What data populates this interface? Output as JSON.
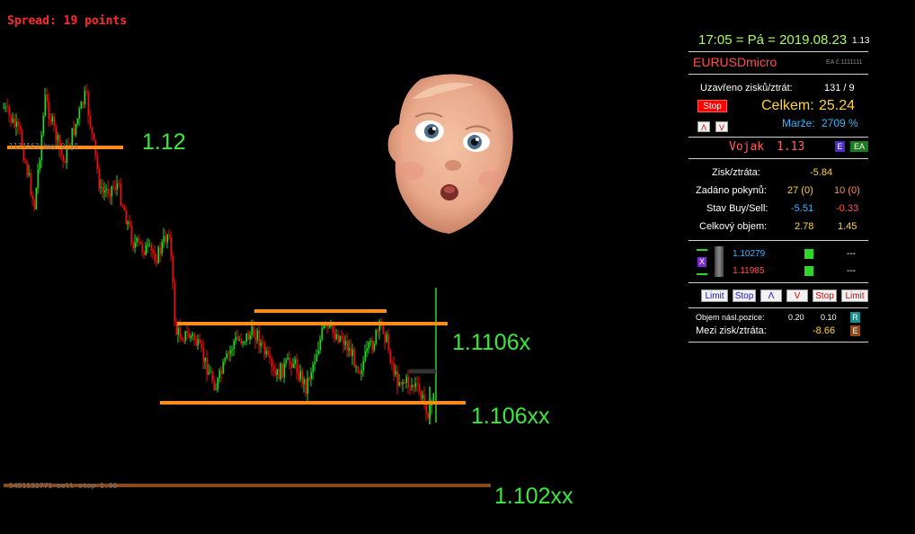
{
  "header": {
    "spread": "Spread: 19 points"
  },
  "levels": {
    "l1": "1.12",
    "l2": "1.1106x",
    "l3": "1.106xx",
    "l4": "1.102xx"
  },
  "line_labels": {
    "upper": "1134563 buy 0.10",
    "bottom": "5451132771 sell stop 1.90"
  },
  "panel": {
    "time": "17:05 = Pá = 2019.08.23",
    "time_version": "1.13",
    "symbol": "EURUSDmicro",
    "ea_id": "EA č.1111111",
    "closed_label": "Uzavřeno zisků/ztrát:",
    "closed_value": "131 / 9",
    "stop_button": "Stop",
    "total_label": "Celkem:",
    "total_value": "25.24",
    "up_btn": "Λ",
    "down_btn": "V",
    "margin_label": "Marže:",
    "margin_value": "2709 %",
    "ea_name": "Vojak",
    "ea_version": "1.13",
    "e_btn": "E",
    "ea_btn": "EA",
    "pl_label": "Zisk/ztráta:",
    "pl_value": "-5.84",
    "orders_label": "Zadáno pokynů:",
    "orders_buy": "27 (0)",
    "orders_sell": "10 (0)",
    "state_label": "Stav Buy/Sell:",
    "state_buy": "-5.51",
    "state_sell": "-0.33",
    "volume_label": "Celkový objem:",
    "volume_buy": "2.78",
    "volume_sell": "1.45",
    "x_btn": "X",
    "price_buy": "1.10279",
    "price_sell": "1.11985",
    "dash1": "---",
    "dash2": "---",
    "actions": [
      "Limit",
      "Stop",
      "Λ",
      "V",
      "Stop",
      "Limit"
    ],
    "next_label": "Objem násl.pozice:",
    "next_buy": "0.20",
    "next_sell": "0.10",
    "r_btn": "R",
    "between_label": "Mezi zisk/ztráta:",
    "between_value": "-8.66",
    "e2_btn": "E"
  },
  "colors": {
    "bull": "#2bd82b",
    "bear": "#e01414",
    "line": "#ff8c1a",
    "level_text": "#3de83d",
    "panel_yellow": "#ffd23c",
    "panel_blue": "#38b8ff"
  }
}
